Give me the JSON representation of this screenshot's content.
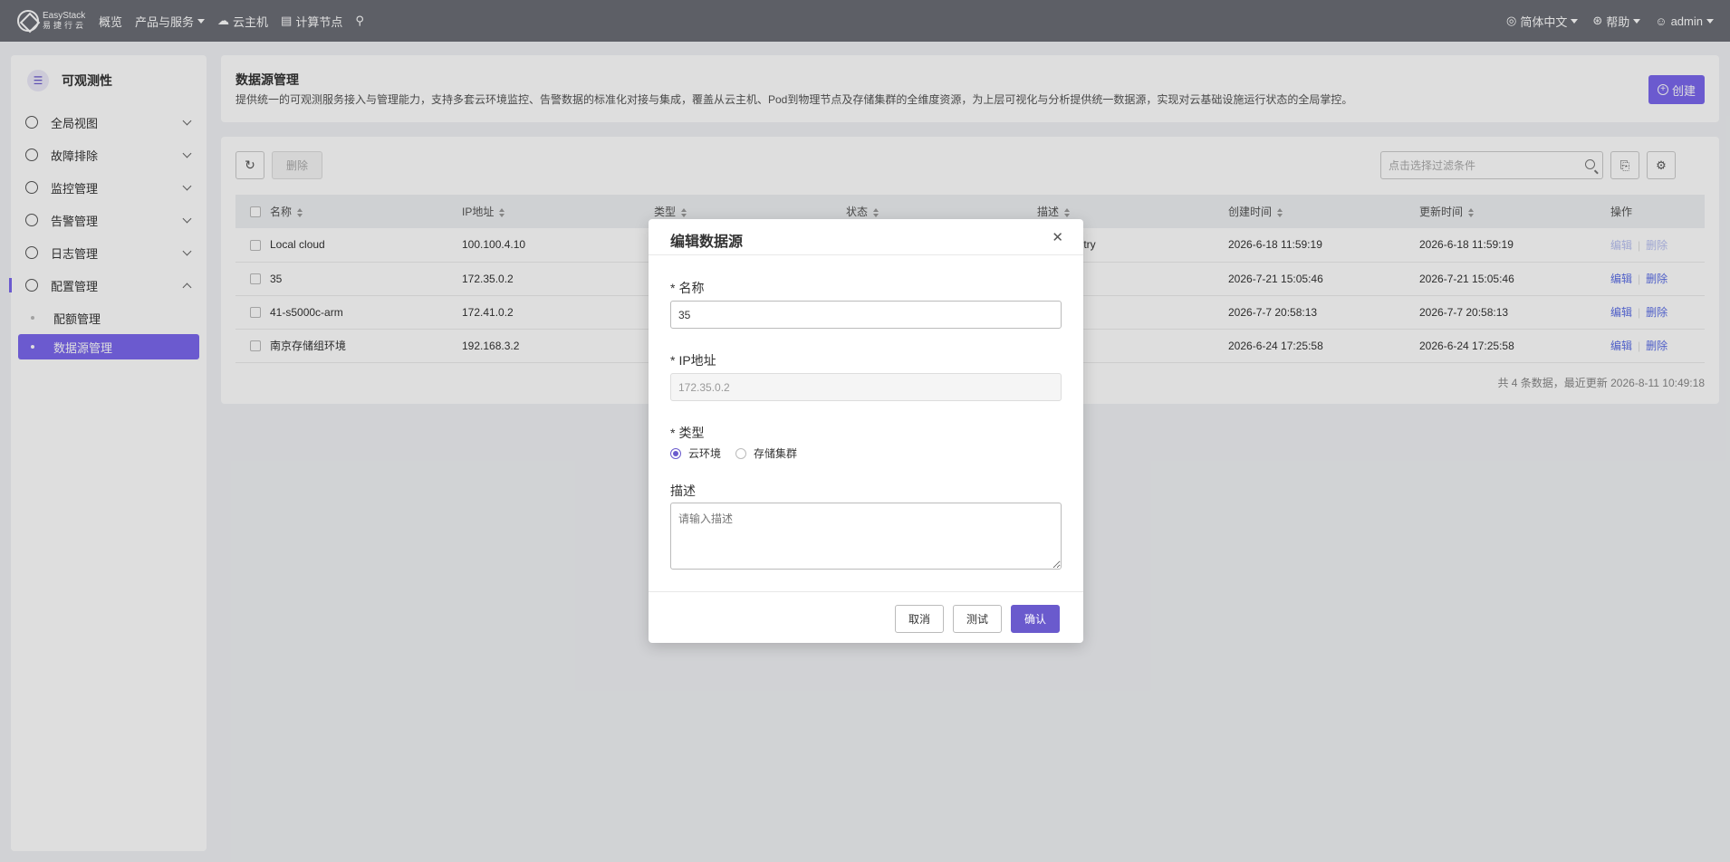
{
  "topbar": {
    "logo_line1": "EasyStack",
    "logo_line2": "易捷行云",
    "nav": [
      "概览",
      "产品与服务",
      "云主机",
      "计算节点"
    ],
    "right": [
      "简体中文",
      "帮助",
      "admin"
    ]
  },
  "sidebar": {
    "title": "可观测性",
    "items": [
      {
        "label": "全局视图"
      },
      {
        "label": "故障排除"
      },
      {
        "label": "监控管理"
      },
      {
        "label": "告警管理"
      },
      {
        "label": "日志管理"
      },
      {
        "label": "配置管理"
      }
    ],
    "sub_items": [
      {
        "label": "配额管理"
      },
      {
        "label": "数据源管理"
      }
    ]
  },
  "header": {
    "title": "数据源管理",
    "description": "提供统一的可观测服务接入与管理能力，支持多套云环境监控、告警数据的标准化对接与集成，覆盖从云主机、Pod到物理节点及存储集群的全维度资源，为上层可视化与分析提供统一数据源，实现对云基础设施运行状态的全局掌控。",
    "create_label": "创建"
  },
  "toolbar": {
    "delete_label": "删除",
    "filter_placeholder": "点击选择过滤条件"
  },
  "table": {
    "columns": [
      "名称",
      "IP地址",
      "类型",
      "状态",
      "描述",
      "创建时间",
      "更新时间",
      "操作"
    ],
    "rows": [
      {
        "name": "Local cloud",
        "ip": "100.100.4.10",
        "desc": "entry",
        "created": "2026-6-18 11:59:19",
        "updated": "2026-6-18 11:59:19"
      },
      {
        "name": "35",
        "ip": "172.35.0.2",
        "desc": "",
        "created": "2026-7-21 15:05:46",
        "updated": "2026-7-21 15:05:46"
      },
      {
        "name": "41-s5000c-arm",
        "ip": "172.41.0.2",
        "desc": "",
        "created": "2026-7-7 20:58:13",
        "updated": "2026-7-7 20:58:13"
      },
      {
        "name": "南京存储组环境",
        "ip": "192.168.3.2",
        "desc": "",
        "created": "2026-6-24 17:25:58",
        "updated": "2026-6-24 17:25:58"
      }
    ],
    "edit_label": "编辑",
    "delete_label": "删除",
    "footer": "共 4 条数据，最近更新   2026-8-11 10:49:18"
  },
  "modal": {
    "title": "编辑数据源",
    "name_label": "名称",
    "name_value": "35",
    "ip_label": "IP地址",
    "ip_value": "172.35.0.2",
    "type_label": "类型",
    "type_options": [
      "云环境",
      "存储集群"
    ],
    "desc_label": "描述",
    "desc_placeholder": "请输入描述",
    "cancel_label": "取消",
    "test_label": "测试",
    "confirm_label": "确认"
  },
  "colors": {
    "accent": "#7b68ee",
    "topbar": "#6b6e76",
    "link": "#5b6ee6"
  }
}
